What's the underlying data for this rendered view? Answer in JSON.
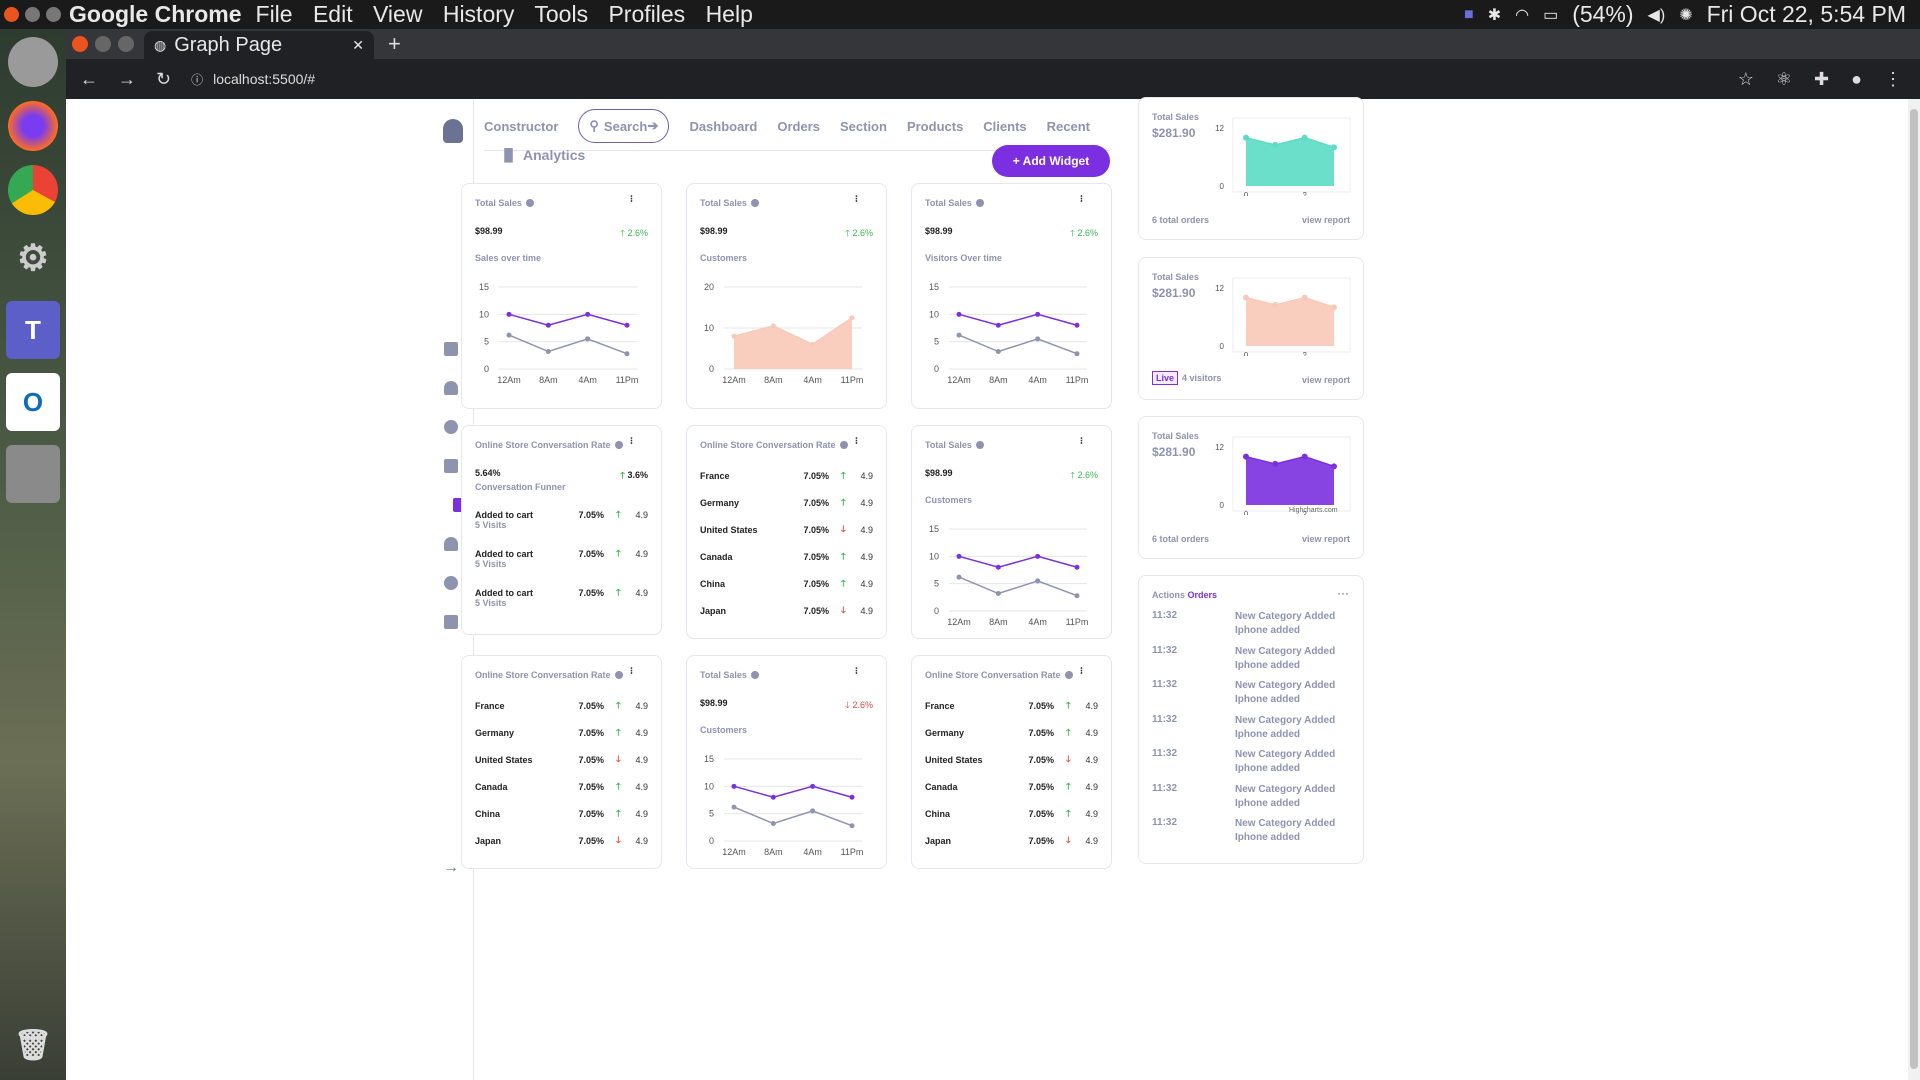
{
  "os_bar": {
    "app_name": "Google Chrome",
    "menu": [
      "File",
      "Edit",
      "View",
      "History",
      "Tools",
      "Profiles",
      "Help"
    ],
    "battery": "(54%)",
    "clock": "Fri Oct 22,  5:54 PM"
  },
  "browser": {
    "tab_title": "Graph Page",
    "url": "localhost:5500/#"
  },
  "nav": {
    "brand": "Constructor",
    "search_placeholder": "Search",
    "links": [
      "Dashboard",
      "Orders",
      "Section",
      "Products",
      "Clients",
      "Recent"
    ]
  },
  "analytics_title": "Analytics",
  "add_widget": "+ Add Widget",
  "cards": {
    "c1": {
      "title": "Total Sales",
      "price": "$98.99",
      "change": "2.6%",
      "sub": "Sales over time"
    },
    "c2": {
      "title": "Total Sales",
      "price": "$98.99",
      "change": "2.6%",
      "sub": "Customers"
    },
    "c3": {
      "title": "Total Sales",
      "price": "$98.99",
      "change": "2.6%",
      "sub": "Visitors Over time"
    },
    "c4": {
      "title": "Online Store Conversation Rate",
      "price": "5.64%",
      "change": "3.6%",
      "sub": "Conversation Funner",
      "rows": [
        {
          "name": "Added to cart",
          "visits": "5 Visits",
          "pct": "7.05%",
          "val": "4.9"
        },
        {
          "name": "Added to cart",
          "visits": "5 Visits",
          "pct": "7.05%",
          "val": "4.9"
        },
        {
          "name": "Added to cart",
          "visits": "5 Visits",
          "pct": "7.05%",
          "val": "4.9"
        }
      ]
    },
    "c5": {
      "title": "Online Store Conversation Rate"
    },
    "c6": {
      "title": "Total Sales",
      "price": "$98.99",
      "change": "2.6%",
      "sub": "Customers"
    },
    "c7": {
      "title": "Online Store Conversation Rate"
    },
    "c8": {
      "title": "Total Sales",
      "price": "$98.99",
      "change": "2.6%",
      "sub": "Customers"
    },
    "c9": {
      "title": "Online Store Conversation Rate"
    }
  },
  "countries": [
    {
      "name": "France",
      "pct": "7.05%",
      "val": "4.9",
      "dir": "up"
    },
    {
      "name": "Germany",
      "pct": "7.05%",
      "val": "4.9",
      "dir": "up"
    },
    {
      "name": "United States",
      "pct": "7.05%",
      "val": "4.9",
      "dir": "down"
    },
    {
      "name": "Canada",
      "pct": "7.05%",
      "val": "4.9",
      "dir": "up"
    },
    {
      "name": "China",
      "pct": "7.05%",
      "val": "4.9",
      "dir": "up"
    },
    {
      "name": "Japan",
      "pct": "7.05%",
      "val": "4.9",
      "dir": "down"
    }
  ],
  "chart_data": [
    {
      "type": "line",
      "categories": [
        "12Am",
        "8Am",
        "4Am",
        "11Pm"
      ],
      "ylim": [
        0,
        15
      ],
      "yticks": [
        0,
        5,
        10,
        15
      ],
      "series": [
        {
          "values": [
            10,
            8,
            10,
            8
          ],
          "color": "#7b2fe0"
        },
        {
          "values": [
            6.2,
            3.2,
            5.5,
            2.8
          ],
          "color": "#8e94b0"
        }
      ]
    },
    {
      "type": "area",
      "categories": [
        "12Am",
        "8Am",
        "4Am",
        "11Pm"
      ],
      "ylim": [
        0,
        20
      ],
      "yticks": [
        0,
        10,
        20
      ],
      "series": [
        {
          "values": [
            8,
            10.5,
            6,
            12.5
          ],
          "color": "#f9c9b8"
        }
      ]
    },
    {
      "type": "area",
      "x": [
        0,
        1,
        2,
        3
      ],
      "xticks": [
        "0",
        "2"
      ],
      "ylim": [
        0,
        12
      ],
      "yticks": [
        0,
        12
      ],
      "series": [
        {
          "values": [
            10,
            8.5,
            10,
            8
          ],
          "color": "#5cdcc5"
        }
      ]
    },
    {
      "type": "area",
      "x": [
        0,
        1,
        2,
        3
      ],
      "xticks": [
        "0",
        "2"
      ],
      "ylim": [
        0,
        12
      ],
      "yticks": [
        0,
        12
      ],
      "series": [
        {
          "values": [
            10,
            8.5,
            10,
            8
          ],
          "color": "#f9c9b8"
        }
      ]
    },
    {
      "type": "area",
      "x": [
        0,
        1,
        2,
        3
      ],
      "xticks": [
        "0",
        "2"
      ],
      "ylim": [
        0,
        12
      ],
      "yticks": [
        0,
        12
      ],
      "series": [
        {
          "values": [
            10,
            8.5,
            10,
            8
          ],
          "color": "#7b2fe0"
        }
      ]
    }
  ],
  "right": {
    "r1": {
      "title": "Total Sales",
      "value": "$281.90",
      "footer": "6 total orders",
      "link": "view report"
    },
    "r2": {
      "title": "Total Sales",
      "value": "$281.90",
      "live": "Live",
      "footer": "4 visitors",
      "link": "view report"
    },
    "r3": {
      "title": "Total Sales",
      "value": "$281.90",
      "credit": "Highcharts.com",
      "footer": "6 total orders",
      "link": "view report"
    },
    "actions": {
      "title": "Actions",
      "title_accent": "Orders",
      "items": [
        {
          "time": "11:32",
          "line1": "New Category Added",
          "line2": "Iphone added"
        },
        {
          "time": "11:32",
          "line1": "New Category Added",
          "line2": "Iphone added"
        },
        {
          "time": "11:32",
          "line1": "New Category Added",
          "line2": "Iphone added"
        },
        {
          "time": "11:32",
          "line1": "New Category Added",
          "line2": "Iphone added"
        },
        {
          "time": "11:32",
          "line1": "New Category Added",
          "line2": "Iphone added"
        },
        {
          "time": "11:32",
          "line1": "New Category Added",
          "line2": "Iphone added"
        },
        {
          "time": "11:32",
          "line1": "New Category Added",
          "line2": "Iphone added"
        }
      ]
    }
  }
}
